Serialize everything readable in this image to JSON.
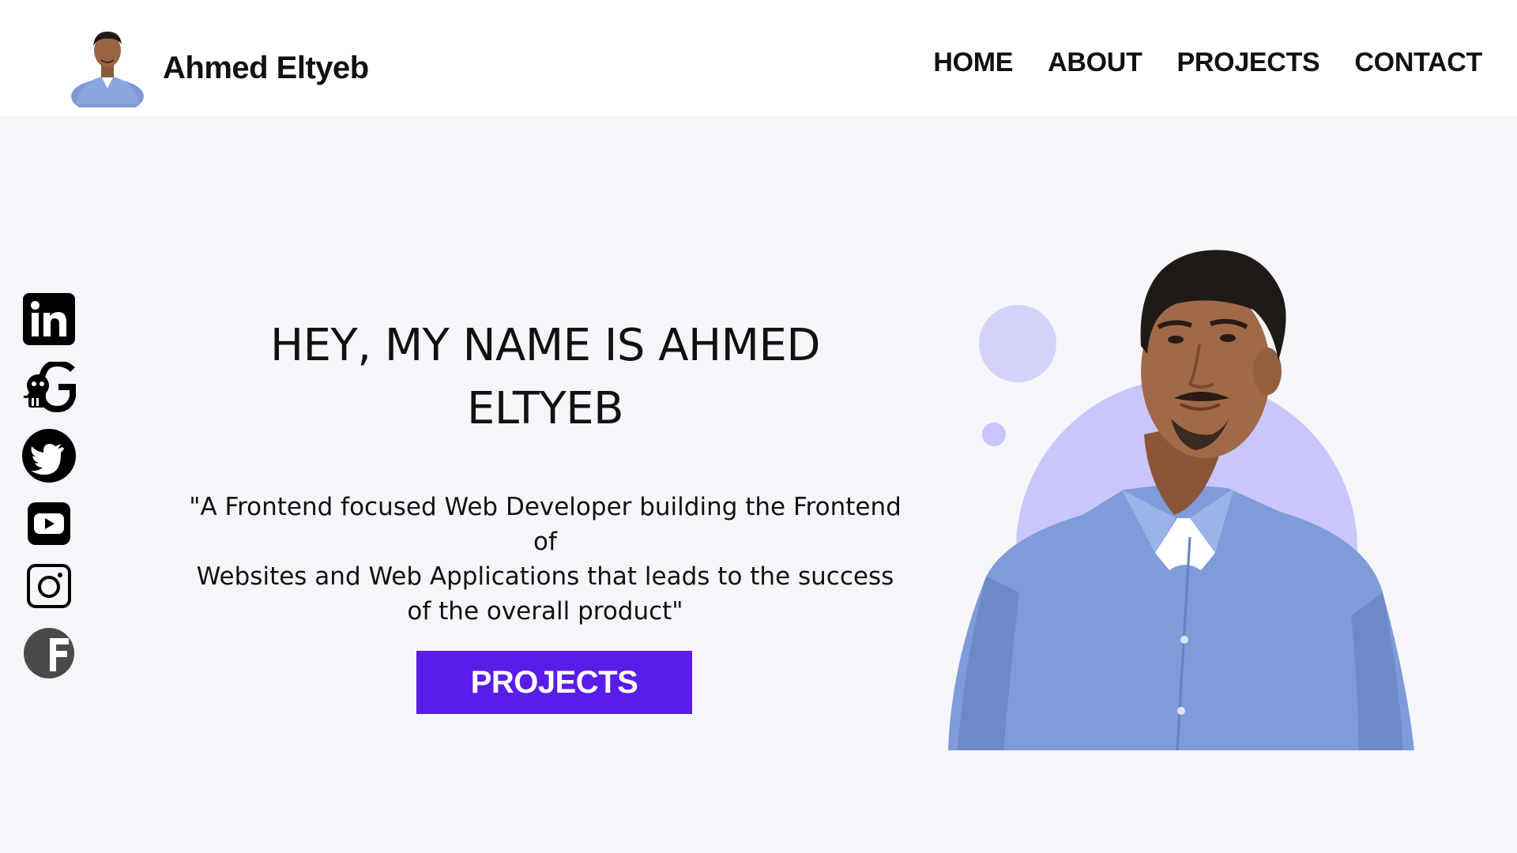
{
  "header": {
    "brand_name": "Ahmed Eltyeb",
    "nav": [
      {
        "label": "HOME"
      },
      {
        "label": "ABOUT"
      },
      {
        "label": "PROJECTS"
      },
      {
        "label": "CONTACT"
      }
    ]
  },
  "social": [
    {
      "icon": "linkedin-icon"
    },
    {
      "icon": "github-icon"
    },
    {
      "icon": "twitter-icon"
    },
    {
      "icon": "youtube-icon"
    },
    {
      "icon": "instagram-icon"
    },
    {
      "icon": "freecodecamp-icon"
    }
  ],
  "hero": {
    "title_line1": "HEY, MY NAME IS AHMED",
    "title_line2": "ELTYEB",
    "quote_line1": "\"A Frontend focused Web Developer building the Frontend of",
    "quote_line2": "Websites and Web Applications that leads to the success",
    "quote_line3": "of the overall product\"",
    "cta_label": "PROJECTS"
  },
  "colors": {
    "accent": "#5a1ce8",
    "decor": "#c9c6fb",
    "background": "#f6f6fa",
    "header_bg": "#ffffff"
  }
}
